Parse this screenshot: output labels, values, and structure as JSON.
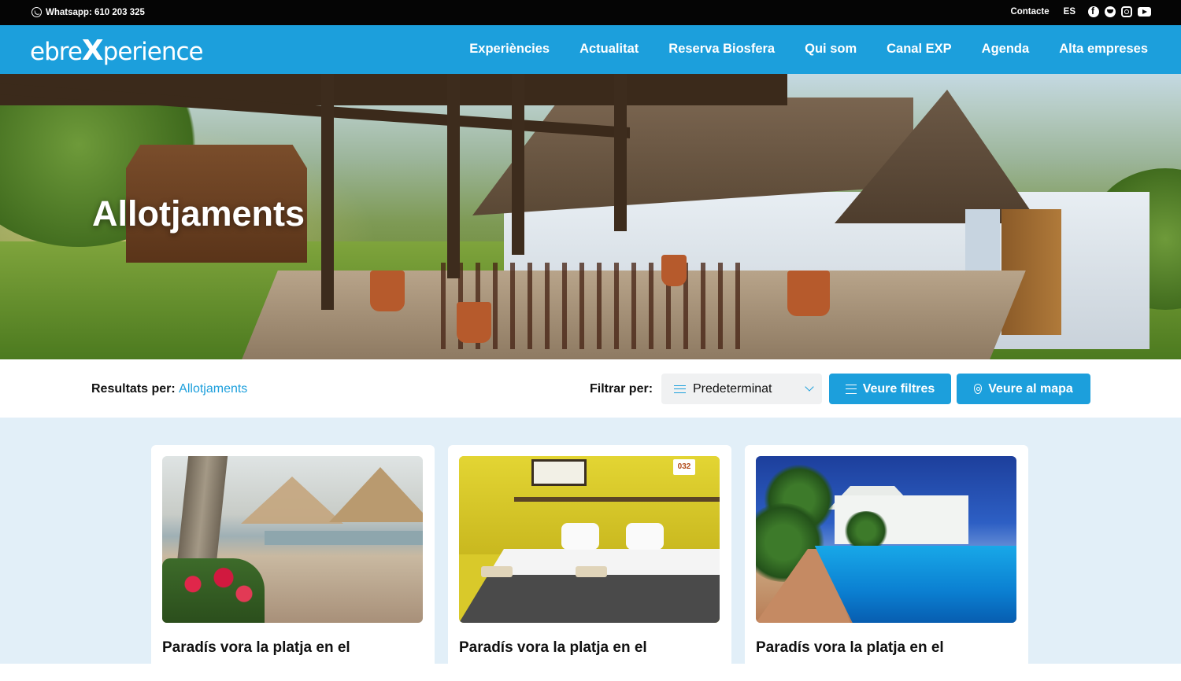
{
  "topbar": {
    "whatsapp": "Whatsapp: 610 203 325",
    "contact": "Contacte",
    "lang": "ES",
    "social": [
      "facebook-icon",
      "twitter-icon",
      "instagram-icon",
      "youtube-icon"
    ]
  },
  "brand": {
    "logo_pre": "ebre",
    "logo_x": "X",
    "logo_post": "perience"
  },
  "nav": {
    "items": [
      "Experiències",
      "Actualitat",
      "Reserva Biosfera",
      "Qui som",
      "Canal EXP",
      "Agenda",
      "Alta empreses"
    ]
  },
  "hero": {
    "title": "Allotjaments"
  },
  "results": {
    "label": "Resultats per:",
    "category": "Allotjaments",
    "filter_label": "Filtrar per:",
    "sort_value": "Predeterminat",
    "filters_button": "Veure filtres",
    "map_button": "Veure al mapa"
  },
  "cards": [
    {
      "title": "Paradís vora la platja en el"
    },
    {
      "title": "Paradís vora la platja en el",
      "image_sign": "032"
    },
    {
      "title": "Paradís vora la platja en el"
    }
  ],
  "colors": {
    "accent": "#1c9fdc",
    "topbar": "#050505",
    "listing_bg": "#e2eff8"
  }
}
